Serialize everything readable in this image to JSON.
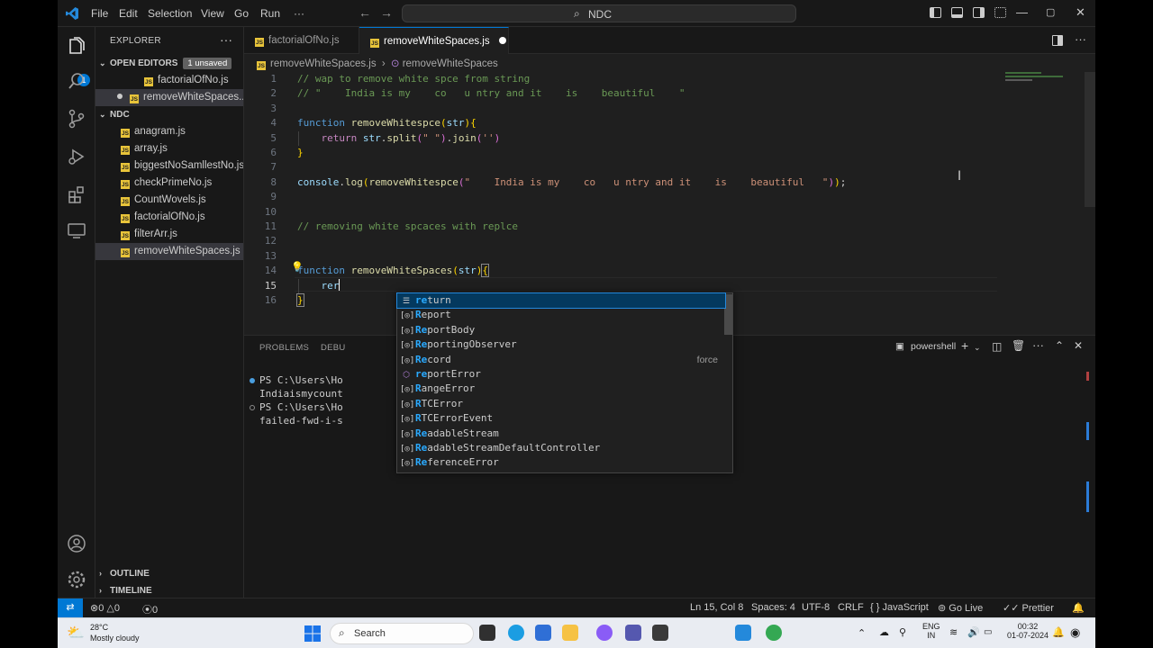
{
  "window": {
    "command_center": "NDC"
  },
  "menu": [
    "File",
    "Edit",
    "Selection",
    "View",
    "Go",
    "Run",
    "···"
  ],
  "sidebar": {
    "title": "EXPLORER",
    "open_editors_label": "OPEN EDITORS",
    "unsaved_badge": "1 unsaved",
    "open_editors": [
      "factorialOfNo.js",
      "removeWhiteSpaces..."
    ],
    "folder": "NDC",
    "files": [
      "anagram.js",
      "array.js",
      "biggestNoSamllestNo.js",
      "checkPrimeNo.js",
      "CountWovels.js",
      "factorialOfNo.js",
      "filterArr.js",
      "removeWhiteSpaces.js"
    ],
    "outline_label": "OUTLINE",
    "timeline_label": "TIMELINE",
    "activity_badge": "1"
  },
  "tabs": [
    {
      "label": "factorialOfNo.js"
    },
    {
      "label": "removeWhiteSpaces.js"
    }
  ],
  "breadcrumb": {
    "file": "removeWhiteSpaces.js",
    "symbol": "removeWhiteSpaces"
  },
  "editor": {
    "line_numbers": [
      "1",
      "2",
      "3",
      "4",
      "5",
      "6",
      "7",
      "8",
      "9",
      "10",
      "11",
      "12",
      "13",
      "14",
      "15",
      "16"
    ],
    "lines": {
      "l1": "// wap to remove white spce from string",
      "l2": "// \"    India is my    co   u ntry and it    is    beautiful    \"",
      "l4a": "function",
      "l4b": "removeWhitespce",
      "l4c": "str",
      "l5a": "return",
      "l5b": "str",
      "l5c": "split",
      "l5d": "\" \"",
      "l5e": "join",
      "l5f": "''",
      "l8a": "console",
      "l8b": "log",
      "l8c": "removeWhitespce",
      "l8d": "\"    India is my    co   u ntry and it    is    beautiful   \"",
      "l11": "// removing white spcaces with replce",
      "l14a": "function",
      "l14b": "removeWhiteSpaces",
      "l14c": "str",
      "l15": "rer"
    }
  },
  "suggestions": [
    {
      "label": "return",
      "match": "re",
      "rest": "turn",
      "icon": "snippet-icon",
      "detail": ""
    },
    {
      "label": "Report",
      "match": "R",
      "rest": "eport",
      "icon": "variable-icon",
      "detail": ""
    },
    {
      "label": "ReportBody",
      "match": "Re",
      "rest": "portBody",
      "icon": "variable-icon",
      "detail": ""
    },
    {
      "label": "ReportingObserver",
      "match": "Re",
      "rest": "portingObserver",
      "icon": "variable-icon",
      "detail": ""
    },
    {
      "label": "Record",
      "match": "Re",
      "rest": "cord",
      "icon": "variable-icon",
      "detail": "force"
    },
    {
      "label": "reportError",
      "match": "re",
      "rest": "portError",
      "icon": "method-icon",
      "detail": ""
    },
    {
      "label": "RangeError",
      "match": "R",
      "rest": "angeError",
      "icon": "variable-icon",
      "detail": ""
    },
    {
      "label": "RTCError",
      "match": "R",
      "rest": "TCError",
      "icon": "variable-icon",
      "detail": ""
    },
    {
      "label": "RTCErrorEvent",
      "match": "R",
      "rest": "TCErrorEvent",
      "icon": "variable-icon",
      "detail": ""
    },
    {
      "label": "ReadableStream",
      "match": "Re",
      "rest": "adableStream",
      "icon": "variable-icon",
      "detail": ""
    },
    {
      "label": "ReadableStreamDefaultController",
      "match": "Re",
      "rest": "adableStreamDefaultController",
      "icon": "variable-icon",
      "detail": ""
    },
    {
      "label": "ReferenceError",
      "match": "Re",
      "rest": "ferenceError",
      "icon": "variable-icon",
      "detail": ""
    }
  ],
  "panel": {
    "tabs": [
      "PROBLEMS",
      "DEBU"
    ],
    "terminal_name": "powershell",
    "terminal_lines": [
      "PS C:\\Users\\Ho",
      "Indiaismycount",
      "PS C:\\Users\\Ho",
      "failed-fwd-i-s"
    ]
  },
  "statusbar": {
    "errors": "0",
    "warnings": "0",
    "ports": "0",
    "position": "Ln 15, Col 8",
    "spaces": "Spaces: 4",
    "encoding": "UTF-8",
    "eol": "CRLF",
    "language": "JavaScript",
    "golive": "Go Live",
    "prettier": "Prettier"
  },
  "taskbar": {
    "temp": "28°C",
    "weather": "Mostly cloudy",
    "search": "Search",
    "lang1": "ENG",
    "lang2": "IN",
    "time": "00:32",
    "date": "01-07-2024"
  },
  "colors": {
    "accent": "#0078d4",
    "editor_bg": "#1f1f1f",
    "chrome_bg": "#181818",
    "js_icon": "#e8c43a"
  }
}
